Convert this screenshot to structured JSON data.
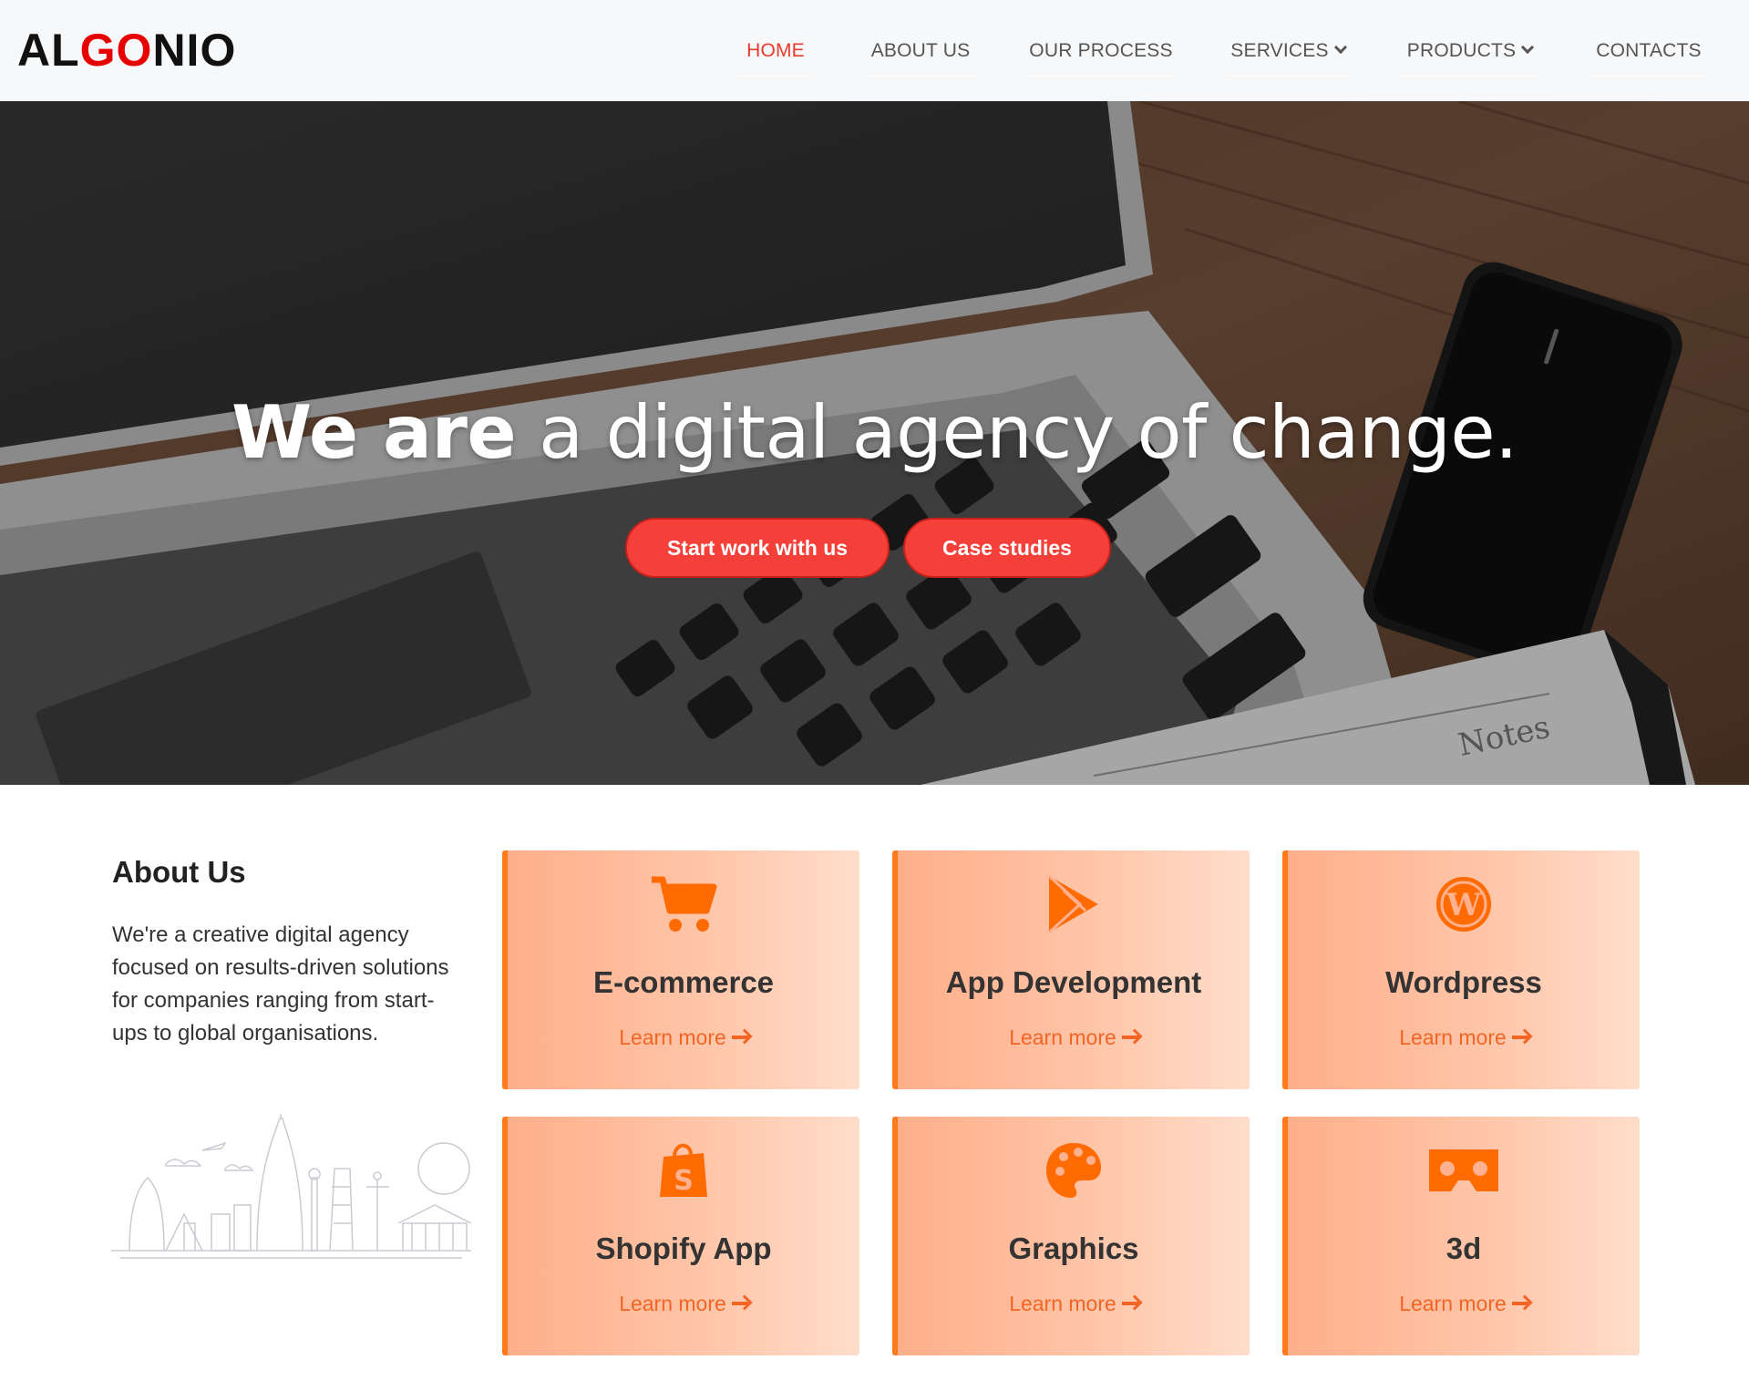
{
  "brand": {
    "part1": "AL",
    "part2": "GO",
    "part3": "NIO"
  },
  "nav": {
    "items": [
      {
        "label": "HOME",
        "active": true
      },
      {
        "label": "ABOUT US"
      },
      {
        "label": "OUR PROCESS"
      },
      {
        "label": "SERVICES",
        "dropdown": true
      },
      {
        "label": "PRODUCTS",
        "dropdown": true
      },
      {
        "label": "CONTACTS"
      }
    ]
  },
  "hero": {
    "title_strong": "We are",
    "title_light": "a digital agency of change.",
    "primary_button": "Start work with us",
    "secondary_button": "Case studies"
  },
  "about": {
    "title": "About Us",
    "text": "We're a creative digital agency focused on results-driven solutions for companies ranging from start-ups to global organisations."
  },
  "services": [
    {
      "title": "E-commerce",
      "link": "Learn more",
      "icon": "cart-icon"
    },
    {
      "title": "App Development",
      "link": "Learn more",
      "icon": "play-store-icon"
    },
    {
      "title": "Wordpress",
      "link": "Learn more",
      "icon": "wordpress-icon"
    },
    {
      "title": "Shopify App",
      "link": "Learn more",
      "icon": "shopify-icon"
    },
    {
      "title": "Graphics",
      "link": "Learn more",
      "icon": "palette-icon"
    },
    {
      "title": "3d",
      "link": "Learn more",
      "icon": "vr-headset-icon"
    }
  ],
  "colors": {
    "accent": "#f5403a",
    "card_accent": "#ff7a1a",
    "link": "#f26524"
  }
}
